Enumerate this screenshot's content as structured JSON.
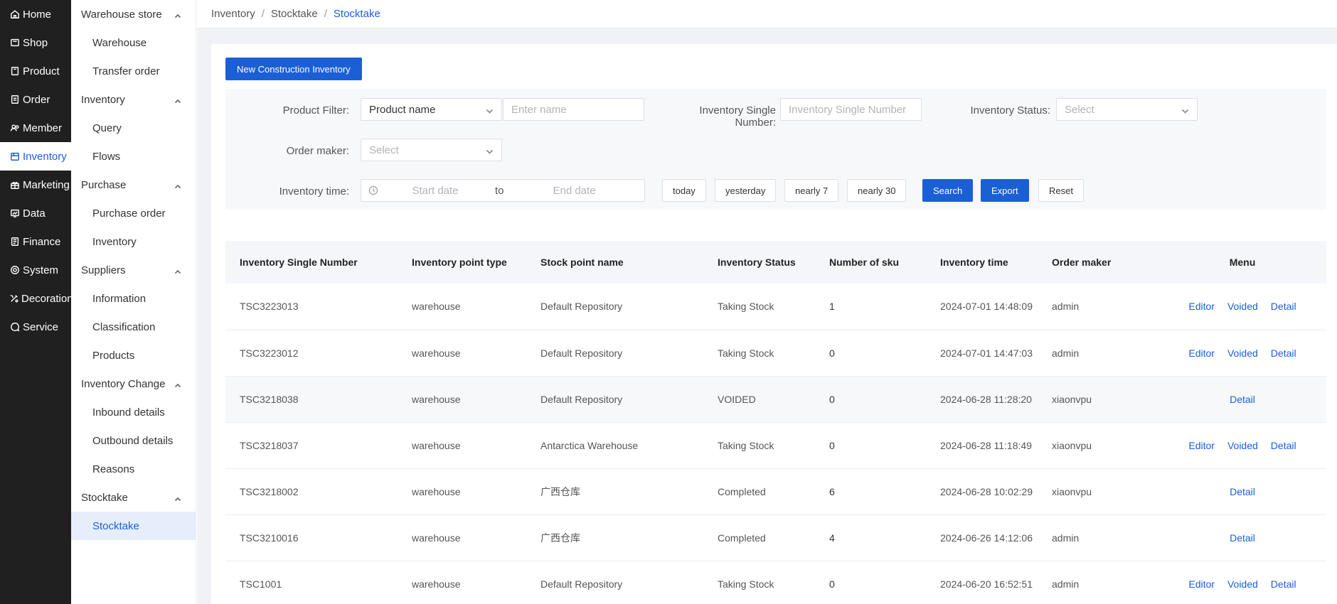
{
  "primary_nav": [
    {
      "label": "Home",
      "icon": "home-icon"
    },
    {
      "label": "Shop",
      "icon": "shop-icon"
    },
    {
      "label": "Product",
      "icon": "product-icon"
    },
    {
      "label": "Order",
      "icon": "order-icon"
    },
    {
      "label": "Member",
      "icon": "member-icon"
    },
    {
      "label": "Inventory",
      "icon": "inventory-icon",
      "active": true
    },
    {
      "label": "Marketing",
      "icon": "marketing-icon"
    },
    {
      "label": "Data",
      "icon": "data-icon"
    },
    {
      "label": "Finance",
      "icon": "finance-icon"
    },
    {
      "label": "System",
      "icon": "system-icon"
    },
    {
      "label": "Decoration",
      "icon": "decoration-icon"
    },
    {
      "label": "Service",
      "icon": "service-icon"
    }
  ],
  "secondary_nav": {
    "warehouse_store": {
      "label": "Warehouse store",
      "items": [
        "Warehouse",
        "Transfer order"
      ]
    },
    "inventory": {
      "label": "Inventory",
      "items": [
        "Query",
        "Flows"
      ]
    },
    "purchase": {
      "label": "Purchase",
      "items": [
        "Purchase order",
        "Inventory"
      ]
    },
    "suppliers": {
      "label": "Suppliers",
      "items": [
        "Information",
        "Classification",
        "Products"
      ]
    },
    "inventory_change": {
      "label": "Inventory Change",
      "items": [
        "Inbound details",
        "Outbound details",
        "Reasons"
      ]
    },
    "stocktake": {
      "label": "Stocktake",
      "items": [
        "Stocktake"
      ]
    }
  },
  "breadcrumb": [
    "Inventory",
    "Stocktake",
    "Stocktake"
  ],
  "new_button": "New Construction Inventory",
  "filter": {
    "product_filter_label": "Product Filter:",
    "product_filter_select": "Product name",
    "product_name_placeholder": "Enter name",
    "single_number_label": "Inventory Single Number:",
    "single_number_placeholder": "Inventory Single Number",
    "status_label": "Inventory Status:",
    "status_placeholder": "Select",
    "order_maker_label": "Order maker:",
    "order_maker_placeholder": "Select",
    "time_label": "Inventory time:",
    "start_placeholder": "Start date",
    "to": "to",
    "end_placeholder": "End date",
    "quick": [
      "today",
      "yesterday",
      "nearly 7",
      "nearly 30"
    ],
    "search": "Search",
    "export": "Export",
    "reset": "Reset"
  },
  "table": {
    "columns": [
      "Inventory Single Number",
      "Inventory point type",
      "Stock point name",
      "Inventory Status",
      "Number of sku",
      "Inventory time",
      "Order maker",
      "Menu"
    ],
    "rows": [
      {
        "number": "TSC3223013",
        "type": "warehouse",
        "point": "Default Repository",
        "status": "Taking Stock",
        "sku": "1",
        "time": "2024-07-01 14:48:09",
        "maker": "admin",
        "actions": [
          "Editor",
          "Voided",
          "Detail"
        ]
      },
      {
        "number": "TSC3223012",
        "type": "warehouse",
        "point": "Default Repository",
        "status": "Taking Stock",
        "sku": "0",
        "time": "2024-07-01 14:47:03",
        "maker": "admin",
        "actions": [
          "Editor",
          "Voided",
          "Detail"
        ]
      },
      {
        "number": "TSC3218038",
        "type": "warehouse",
        "point": "Default Repository",
        "status": "VOIDED",
        "sku": "0",
        "time": "2024-06-28 11:28:20",
        "maker": "xiaonvpu",
        "actions": [
          "Detail"
        ]
      },
      {
        "number": "TSC3218037",
        "type": "warehouse",
        "point": "Antarctica Warehouse",
        "status": "Taking Stock",
        "sku": "0",
        "time": "2024-06-28 11:18:49",
        "maker": "xiaonvpu",
        "actions": [
          "Editor",
          "Voided",
          "Detail"
        ]
      },
      {
        "number": "TSC3218002",
        "type": "warehouse",
        "point": "广西仓库",
        "status": "Completed",
        "sku": "6",
        "time": "2024-06-28 10:02:29",
        "maker": "xiaonvpu",
        "actions": [
          "Detail"
        ]
      },
      {
        "number": "TSC3210016",
        "type": "warehouse",
        "point": "广西仓库",
        "status": "Completed",
        "sku": "4",
        "time": "2024-06-26 14:12:06",
        "maker": "admin",
        "actions": [
          "Detail"
        ]
      },
      {
        "number": "TSC1001",
        "type": "warehouse",
        "point": "Default Repository",
        "status": "Taking Stock",
        "sku": "0",
        "time": "2024-06-20 16:52:51",
        "maker": "admin",
        "actions": [
          "Editor",
          "Voided",
          "Detail"
        ]
      }
    ]
  }
}
